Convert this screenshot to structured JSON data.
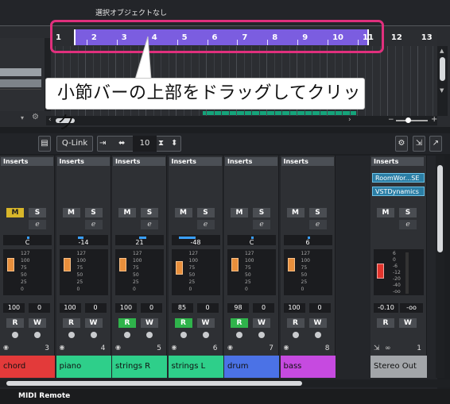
{
  "header": {
    "no_selection": "選択オブジェクトなし"
  },
  "ruler": {
    "bars": [
      "1",
      "2",
      "3",
      "4",
      "5",
      "6",
      "7",
      "8",
      "9",
      "10",
      "11",
      "12",
      "13"
    ]
  },
  "callout": {
    "text": "小節バーの上部をドラッグしてクリック"
  },
  "mixer_toolbar": {
    "qlink": "Q-Link",
    "count": "10"
  },
  "channels": [
    {
      "id": "3",
      "name": "chord",
      "color": "#e33a3a",
      "inserts": "Inserts",
      "pan": "C",
      "vol": "100",
      "vol2": "0",
      "mute": true,
      "solo": false,
      "read": false
    },
    {
      "id": "4",
      "name": "piano",
      "color": "#2ecf8a",
      "inserts": "Inserts",
      "pan": "-14",
      "vol": "100",
      "vol2": "0",
      "mute": false,
      "solo": false,
      "read": false
    },
    {
      "id": "5",
      "name": "strings R",
      "color": "#2ecf8a",
      "inserts": "Inserts",
      "pan": "21",
      "vol": "100",
      "vol2": "0",
      "mute": false,
      "solo": false,
      "read": true
    },
    {
      "id": "6",
      "name": "strings L",
      "color": "#2ecf8a",
      "inserts": "Inserts",
      "pan": "-48",
      "vol": "85",
      "vol2": "0",
      "mute": false,
      "solo": false,
      "read": true
    },
    {
      "id": "7",
      "name": "drum",
      "color": "#4b72e6",
      "inserts": "Inserts",
      "pan": "C",
      "vol": "98",
      "vol2": "0",
      "mute": false,
      "solo": false,
      "read": true
    },
    {
      "id": "8",
      "name": "bass",
      "color": "#c64ae0",
      "inserts": "Inserts",
      "pan": "6",
      "vol": "100",
      "vol2": "0",
      "mute": false,
      "solo": false,
      "read": false
    }
  ],
  "output": {
    "id": "1",
    "name": "Stereo Out",
    "inserts": "Inserts",
    "plugins": [
      "RoomWor...SE",
      "VSTDynamics"
    ],
    "val1": "-0.10",
    "val2": "-oo"
  },
  "fader_scale": [
    "127",
    "100",
    "75",
    "50",
    "25",
    "0"
  ],
  "out_scale": [
    "6",
    "0",
    "-6",
    "-12",
    "-20",
    "-40",
    "-oo"
  ],
  "status": {
    "midi_remote": "MIDI Remote"
  }
}
